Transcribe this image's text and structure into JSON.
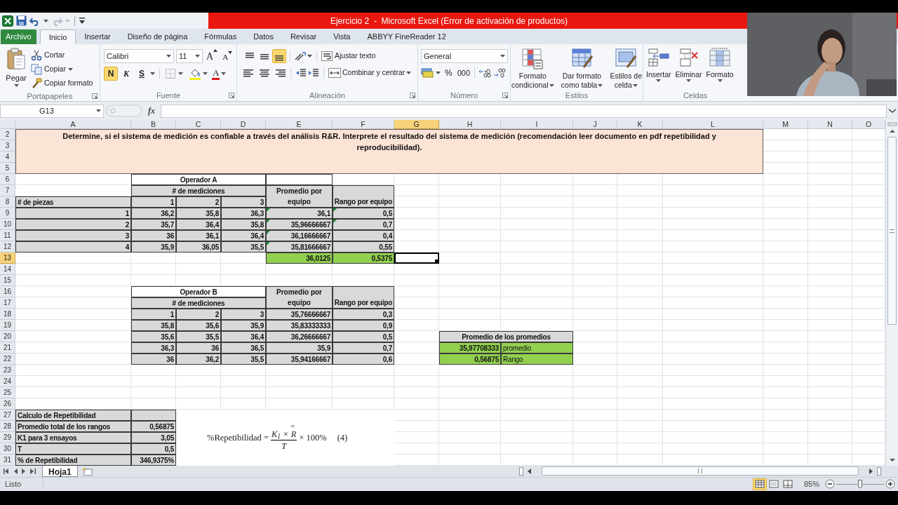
{
  "window": {
    "title": "Ejercicio 2  -  Microsoft Excel (Error de activación de productos)"
  },
  "tabs": [
    {
      "label": "Archivo",
      "kind": "file",
      "selected": false
    },
    {
      "label": "Inicio",
      "kind": "tab",
      "selected": true
    },
    {
      "label": "Insertar",
      "kind": "tab",
      "selected": false
    },
    {
      "label": "Diseño de página",
      "kind": "tab",
      "selected": false
    },
    {
      "label": "Fórmulas",
      "kind": "tab",
      "selected": false
    },
    {
      "label": "Datos",
      "kind": "tab",
      "selected": false
    },
    {
      "label": "Revisar",
      "kind": "tab",
      "selected": false
    },
    {
      "label": "Vista",
      "kind": "tab",
      "selected": false
    },
    {
      "label": "ABBYY FineReader 12",
      "kind": "tab",
      "selected": false
    }
  ],
  "ribbon": {
    "clipboard": {
      "label": "Portapapeles",
      "paste": "Pegar",
      "items": [
        {
          "kind": "cut",
          "label": "Cortar"
        },
        {
          "kind": "copy",
          "label": "Copiar"
        },
        {
          "kind": "format_painter",
          "label": "Copiar formato"
        }
      ]
    },
    "font": {
      "label": "Fuente",
      "font_name": "Calibri",
      "font_size": "11",
      "grow": "A",
      "shrink": "A",
      "styles": [
        {
          "kind": "bold",
          "label": "N",
          "selected": true
        },
        {
          "kind": "italic",
          "label": "K",
          "selected": false
        },
        {
          "kind": "underline",
          "label": "S",
          "selected": false
        }
      ],
      "font_color": "A"
    },
    "alignment": {
      "label": "Alineación",
      "vertical": [
        {
          "kind": "top",
          "selected": false
        },
        {
          "kind": "middle",
          "selected": false
        },
        {
          "kind": "bottom",
          "selected": true
        }
      ],
      "wrap": "Ajustar texto",
      "merge": "Combinar y centrar"
    },
    "number": {
      "label": "Número",
      "format": "General",
      "percent": "%",
      "thousands": "000"
    },
    "styles": {
      "label": "Estilos",
      "items": [
        {
          "kind": "conditional",
          "lines": [
            "Formato",
            "condicional"
          ]
        },
        {
          "kind": "table",
          "lines": [
            "Dar formato",
            "como tabla"
          ]
        },
        {
          "kind": "cell_styles",
          "lines": [
            "Estilos de",
            "celda"
          ]
        }
      ]
    },
    "cells": {
      "label": "Celdas",
      "items": [
        {
          "kind": "insert",
          "label": "Insertar"
        },
        {
          "kind": "delete",
          "label": "Eliminar"
        },
        {
          "kind": "format",
          "label": "Formato"
        }
      ]
    }
  },
  "formula_bar": {
    "name_box": "G13",
    "fx": "fx"
  },
  "sheet": {
    "columns": [
      {
        "label": "A",
        "selected": false
      },
      {
        "label": "B",
        "selected": false
      },
      {
        "label": "C",
        "selected": false
      },
      {
        "label": "D",
        "selected": false
      },
      {
        "label": "E",
        "selected": false
      },
      {
        "label": "F",
        "selected": false
      },
      {
        "label": "G",
        "selected": true
      },
      {
        "label": "H",
        "selected": false
      },
      {
        "label": "I",
        "selected": false
      },
      {
        "label": "J",
        "selected": false
      },
      {
        "label": "K",
        "selected": false
      },
      {
        "label": "L",
        "selected": false
      },
      {
        "label": "M",
        "selected": false
      },
      {
        "label": "N",
        "selected": false
      },
      {
        "label": "O",
        "selected": false
      }
    ],
    "rows": [
      {
        "label": "2",
        "selected": false
      },
      {
        "label": "3",
        "selected": false
      },
      {
        "label": "4",
        "selected": false
      },
      {
        "label": "5",
        "selected": false
      },
      {
        "label": "6",
        "selected": false
      },
      {
        "label": "7",
        "selected": false
      },
      {
        "label": "8",
        "selected": false
      },
      {
        "label": "9",
        "selected": false
      },
      {
        "label": "10",
        "selected": false
      },
      {
        "label": "11",
        "selected": false
      },
      {
        "label": "12",
        "selected": false
      },
      {
        "label": "13",
        "selected": true
      },
      {
        "label": "14",
        "selected": false
      },
      {
        "label": "15",
        "selected": false
      },
      {
        "label": "16",
        "selected": false
      },
      {
        "label": "17",
        "selected": false
      },
      {
        "label": "18",
        "selected": false
      },
      {
        "label": "19",
        "selected": false
      },
      {
        "label": "20",
        "selected": false
      },
      {
        "label": "21",
        "selected": false
      },
      {
        "label": "22",
        "selected": false
      },
      {
        "label": "23",
        "selected": false
      },
      {
        "label": "24",
        "selected": false
      },
      {
        "label": "25",
        "selected": false
      },
      {
        "label": "26",
        "selected": false
      },
      {
        "label": "27",
        "selected": false
      },
      {
        "label": "28",
        "selected": false
      },
      {
        "label": "29",
        "selected": false
      },
      {
        "label": "30",
        "selected": false
      },
      {
        "label": "31",
        "selected": false
      }
    ],
    "instructions": "Determine, si el sistema de medición es confiable a través del análisis R&R. Interprete el resultado del sistema de medición (recomendación leer documento en pdf repetibilidad y reproducibilidad).",
    "operator_a": {
      "title": "Operador A",
      "subtitle": "# de mediciones",
      "average_header": "Promedio por equipo",
      "range_header": "Rango por equipo",
      "pieces_header": "# de piezas",
      "trial_headers": [
        "1",
        "2",
        "3"
      ],
      "rows": [
        {
          "piece": "1",
          "values": [
            "36,2",
            "35,8",
            "36,3"
          ],
          "average": "36,1",
          "range": "0,5",
          "average_flag": true,
          "range_flag": true
        },
        {
          "piece": "2",
          "values": [
            "35,7",
            "36,4",
            "35,8"
          ],
          "average": "35,96666667",
          "range": "0,7",
          "average_flag": true,
          "range_flag": true
        },
        {
          "piece": "3",
          "values": [
            "36",
            "36,1",
            "36,4"
          ],
          "average": "36,16666667",
          "range": "0,4",
          "average_flag": true,
          "range_flag": false
        },
        {
          "piece": "4",
          "values": [
            "35,9",
            "36,05",
            "35,5"
          ],
          "average": "35,81666667",
          "range": "0,55",
          "average_flag": true,
          "range_flag": false
        }
      ],
      "total_average": "36,0125",
      "total_range": "0,5375"
    },
    "operator_b": {
      "title": "Operador B",
      "average_header": "Promedio por equipo",
      "range_header": "Rango por equipo",
      "subtitle": "# de mediciones",
      "rows": [
        {
          "values": [
            "1",
            "2",
            "3"
          ],
          "average": "35,76666667",
          "range": "0,3"
        },
        {
          "values": [
            "35,8",
            "35,6",
            "35,9"
          ],
          "average": "35,83333333",
          "range": "0,9"
        },
        {
          "values": [
            "35,6",
            "35,5",
            "36,4"
          ],
          "average": "36,26666667",
          "range": "0,5"
        },
        {
          "values": [
            "36,3",
            "36",
            "36,5"
          ],
          "average": "35,9",
          "range": "0,7"
        },
        {
          "values": [
            "36",
            "36,2",
            "35,5"
          ],
          "average": "35,94166667",
          "range": "0,6"
        }
      ]
    },
    "summary": {
      "title": "Promedio de los promedios",
      "rows": [
        {
          "result": "35,97708333",
          "description": "promedio"
        },
        {
          "result": "0,56875",
          "description": "Rango"
        }
      ]
    },
    "repeatability": {
      "title": "Calculo de Repetibilidad",
      "rows": [
        {
          "label": "Promedio total de los rangos",
          "value": "0,56875"
        },
        {
          "label": "K1 para 3 ensayos",
          "value": "3,05"
        },
        {
          "label": "T",
          "value": "0,5"
        },
        {
          "label": "% de Repetibilidad",
          "value": "346,9375%"
        }
      ]
    },
    "formula_image": {
      "lhs": "%Repetibilidad =",
      "bar": "=",
      "numerator": "K$_{1}$ × R",
      "denominator": "T",
      "rhs": "× 100%",
      "number": "(4)"
    }
  },
  "sheet_tabs": [
    {
      "label": "Hoja1",
      "selected": true
    }
  ],
  "status_bar": {
    "text": "Listo",
    "views": [
      {
        "kind": "normal",
        "selected": true
      },
      {
        "kind": "page_layout",
        "selected": false
      },
      {
        "kind": "page_break",
        "selected": false
      }
    ],
    "zoom": {
      "reading": "85%",
      "level": 0.5
    }
  }
}
